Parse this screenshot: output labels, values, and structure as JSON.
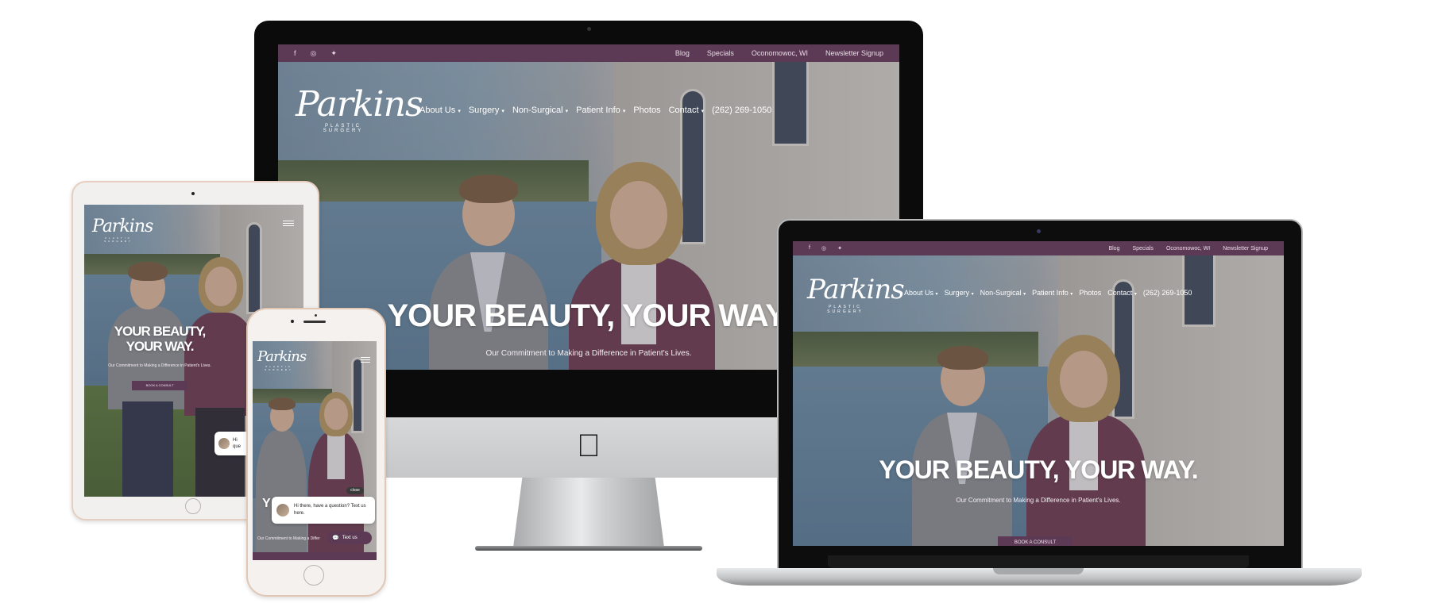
{
  "site": {
    "topbar_links": [
      "Blog",
      "Specials",
      "Oconomowoc, WI",
      "Newsletter Signup"
    ],
    "social_icons": [
      "facebook-icon",
      "instagram-icon",
      "twitter-icon"
    ],
    "logo": {
      "script": "Parkins",
      "sub": "PLASTIC SURGERY"
    },
    "nav": [
      "About Us",
      "Surgery",
      "Non-Surgical",
      "Patient Info",
      "Photos",
      "Contact"
    ],
    "phone": "(262) 269-1050",
    "headline": "YOUR BEAUTY, YOUR WAY.",
    "ipad_headline_line1": "YOUR BEAUTY,",
    "ipad_headline_line2": "YOUR WAY.",
    "subline": "Our Commitment to Making a Difference in Patient's Lives.",
    "cta": "BOOK A CONSULT",
    "brand_color": "#5c3a55"
  },
  "chat": {
    "message": "Hi there, have a question? Text us here.",
    "ipad_partial_line1": "Hi",
    "ipad_partial_line2": "que",
    "close_label": "close",
    "textus_label": "Text us"
  },
  "phone_partials": {
    "headline_fragment": "Y",
    "subline_fragment": "Our Commitment to Making a Differ"
  },
  "glyphs": {
    "apple": "",
    "facebook": "f",
    "instagram": "◎",
    "twitter": "✦",
    "nav_caret": "▾"
  }
}
